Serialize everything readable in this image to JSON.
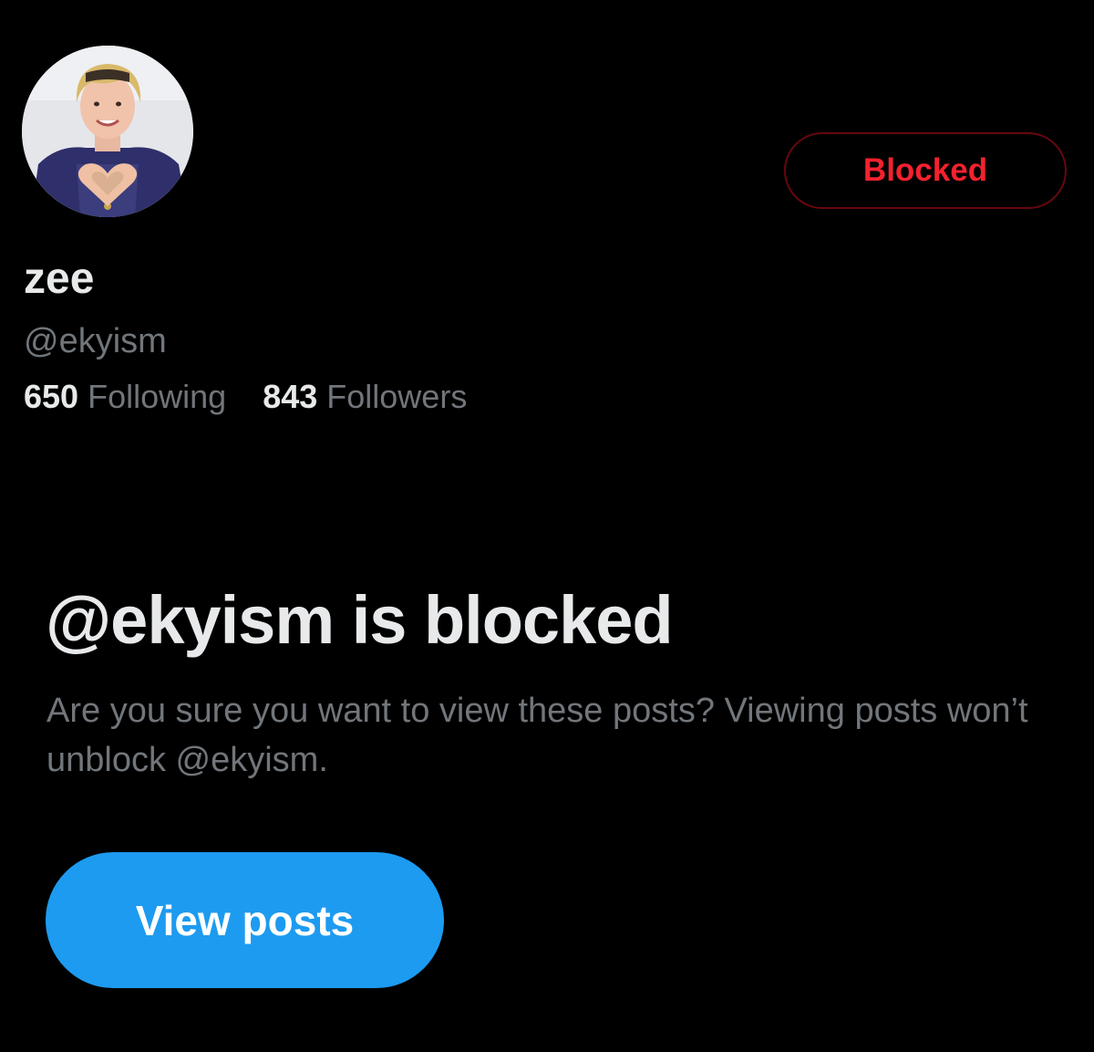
{
  "profile": {
    "display_name": "zee",
    "handle": "@ekyism",
    "avatar_icon": "profile-photo",
    "following_count": "650",
    "following_label": "Following",
    "followers_count": "843",
    "followers_label": "Followers"
  },
  "actions": {
    "blocked_label": "Blocked"
  },
  "blocked_notice": {
    "title": "@ekyism is blocked",
    "description": "Are you sure you want to view these posts? Viewing posts won’t unblock @ekyism.",
    "view_button_label": "View posts"
  },
  "colors": {
    "background": "#000000",
    "primary_text": "#e7e9ea",
    "secondary_text": "#71767b",
    "blocked_red": "#f4212e",
    "accent_blue": "#1d9bf0"
  }
}
